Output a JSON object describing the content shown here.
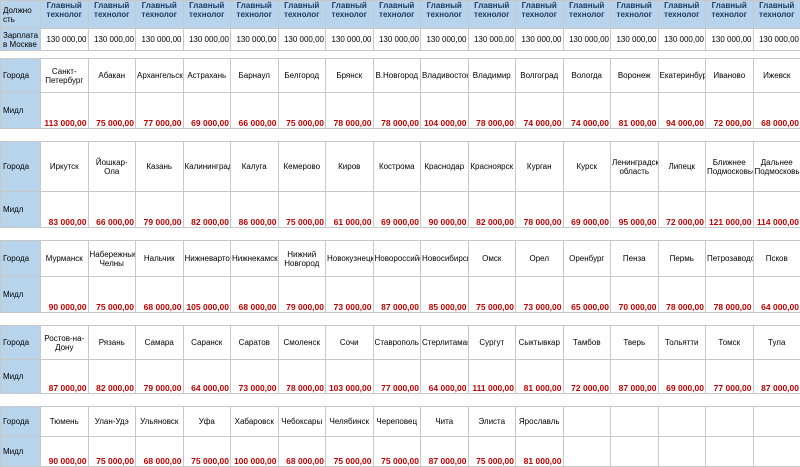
{
  "header": {
    "position_label": "Должно сть",
    "salary_label": "Зарплата в Москве",
    "position_title": "Главный технолог",
    "moscow_salary": "130 000,00"
  },
  "row_labels": {
    "cities": "Города",
    "median": "Мидл"
  },
  "blocks": [
    {
      "cities": [
        "Санкт-Петербург",
        "Абакан",
        "Архангельск",
        "Астрахань",
        "Барнаул",
        "Белгород",
        "Брянск",
        "В.Новгород",
        "Владивосток",
        "Владимир",
        "Волгоград",
        "Вологда",
        "Воронеж",
        "Екатеринбург",
        "Иваново",
        "Ижевск"
      ],
      "medians": [
        "113 000,00",
        "75 000,00",
        "77 000,00",
        "69 000,00",
        "66 000,00",
        "75 000,00",
        "78 000,00",
        "78 000,00",
        "104 000,00",
        "78 000,00",
        "74 000,00",
        "74 000,00",
        "81 000,00",
        "94 000,00",
        "72 000,00",
        "68 000,00"
      ]
    },
    {
      "cities": [
        "Иркутск",
        "Йошкар-Ола",
        "Казань",
        "Калининград",
        "Калуга",
        "Кемерово",
        "Киров",
        "Кострома",
        "Краснодар",
        "Красноярск",
        "Курган",
        "Курск",
        "Ленинградская область",
        "Липецк",
        "Ближнее Подмосковье",
        "Дальнее Подмосковье"
      ],
      "medians": [
        "83 000,00",
        "66 000,00",
        "79 000,00",
        "82 000,00",
        "86 000,00",
        "75 000,00",
        "61 000,00",
        "69 000,00",
        "90 000,00",
        "82 000,00",
        "78 000,00",
        "69 000,00",
        "95 000,00",
        "72 000,00",
        "121 000,00",
        "114 000,00"
      ]
    },
    {
      "cities": [
        "Мурманск",
        "Набережные Челны",
        "Нальчик",
        "Нижневартовск",
        "Нижнекамск",
        "Нижний Новгород",
        "Новокузнецк",
        "Новороссийск",
        "Новосибирск",
        "Омск",
        "Орел",
        "Оренбург",
        "Пенза",
        "Пермь",
        "Петрозаводск",
        "Псков"
      ],
      "medians": [
        "90 000,00",
        "75 000,00",
        "68 000,00",
        "105 000,00",
        "68 000,00",
        "79 000,00",
        "73 000,00",
        "87 000,00",
        "85 000,00",
        "75 000,00",
        "73 000,00",
        "65 000,00",
        "70 000,00",
        "78 000,00",
        "78 000,00",
        "64 000,00"
      ]
    },
    {
      "cities": [
        "Ростов-на-Дону",
        "Рязань",
        "Самара",
        "Саранск",
        "Саратов",
        "Смоленск",
        "Сочи",
        "Ставрополь",
        "Стерлитамак",
        "Сургут",
        "Сыктывкар",
        "Тамбов",
        "Тверь",
        "Тольятти",
        "Томск",
        "Тула"
      ],
      "medians": [
        "87 000,00",
        "82 000,00",
        "79 000,00",
        "64 000,00",
        "73 000,00",
        "78 000,00",
        "103 000,00",
        "77 000,00",
        "64 000,00",
        "111 000,00",
        "81 000,00",
        "72 000,00",
        "87 000,00",
        "69 000,00",
        "77 000,00",
        "87 000,00"
      ]
    },
    {
      "cities": [
        "Тюмень",
        "Улан-Удэ",
        "Ульяновск",
        "Уфа",
        "Хабаровск",
        "Чебоксары",
        "Челябинск",
        "Череповец",
        "Чита",
        "Элиста",
        "Ярославль",
        "",
        "",
        "",
        "",
        ""
      ],
      "medians": [
        "90 000,00",
        "75 000,00",
        "68 000,00",
        "75 000,00",
        "100 000,00",
        "68 000,00",
        "75 000,00",
        "75 000,00",
        "87 000,00",
        "75 000,00",
        "81 000,00",
        "",
        "",
        "",
        "",
        ""
      ]
    }
  ]
}
